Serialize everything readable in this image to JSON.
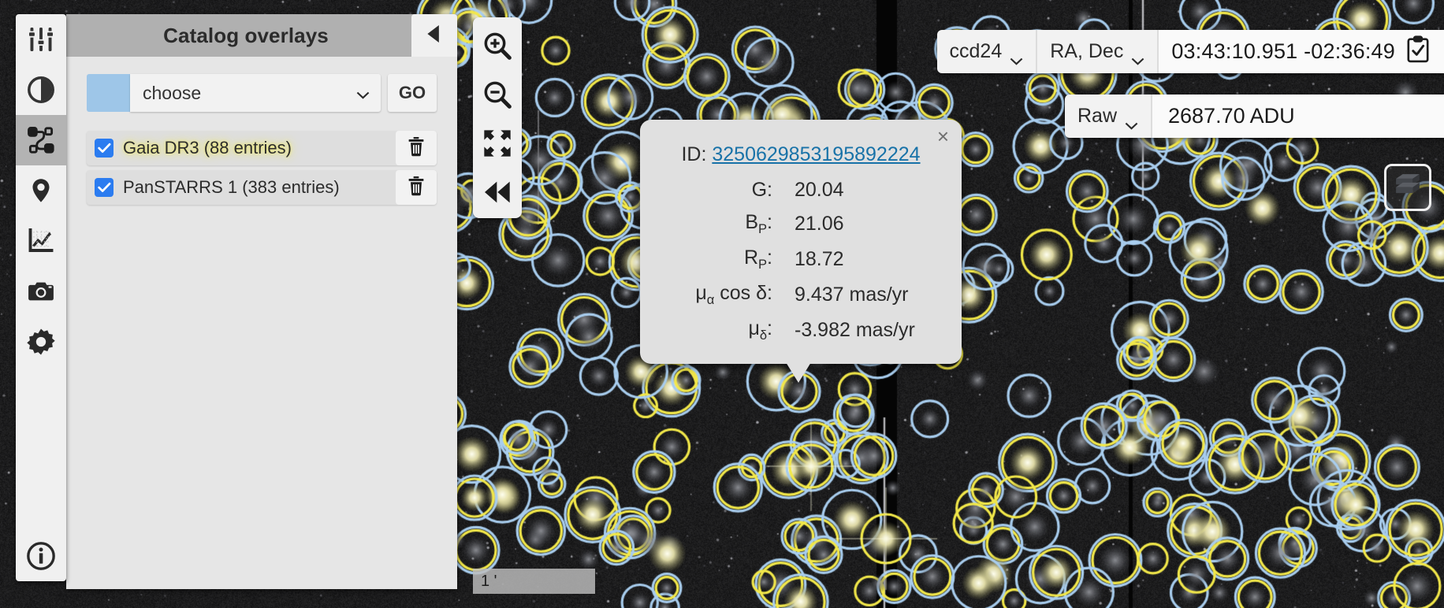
{
  "app": {
    "title": "Astronomical image viewer"
  },
  "rail": {
    "items": [
      {
        "name": "sliders-icon",
        "label": "Adjust",
        "active": false
      },
      {
        "name": "contrast-icon",
        "label": "Contrast",
        "active": false
      },
      {
        "name": "catalog-overlay-icon",
        "label": "Catalog overlays",
        "active": true
      },
      {
        "name": "pin-icon",
        "label": "Markers",
        "active": false
      },
      {
        "name": "chart-icon",
        "label": "Plots",
        "active": false
      },
      {
        "name": "camera-icon",
        "label": "Snapshot",
        "active": false
      },
      {
        "name": "gear-icon",
        "label": "Settings",
        "active": false
      }
    ],
    "info": {
      "name": "info-icon",
      "label": "About"
    }
  },
  "panel": {
    "title": "Catalog overlays",
    "collapse_icon": "chevron-left-icon",
    "chooser": {
      "swatch_color": "#9ec6e8",
      "selected": "choose",
      "options": [
        "choose"
      ],
      "go_label": "GO"
    },
    "catalogs": [
      {
        "label": "Gaia DR3 (88 entries)",
        "checked": true,
        "highlighted": true
      },
      {
        "label": "PanSTARRS 1 (383 entries)",
        "checked": true,
        "highlighted": false
      }
    ]
  },
  "zoom_tools": [
    {
      "name": "zoom-in-icon",
      "label": "Zoom in"
    },
    {
      "name": "zoom-out-icon",
      "label": "Zoom out"
    },
    {
      "name": "fit-to-screen-icon",
      "label": "Zoom to fit"
    },
    {
      "name": "rewind-icon",
      "label": "Reset view"
    }
  ],
  "toolbar": {
    "ccd_selected": "ccd24",
    "ccd_options": [
      "ccd24"
    ],
    "coord_system_selected": "RA, Dec",
    "coord_system_options": [
      "RA, Dec"
    ],
    "coordinates": "03:43:10.951 -02:36:49",
    "copy_icon": "clipboard-check-icon",
    "value_mode_selected": "Raw",
    "value_mode_options": [
      "Raw"
    ],
    "pixel_value": "2687.70 ADU"
  },
  "layers_button": {
    "icon": "layers-cube-icon",
    "label": "Layers"
  },
  "scalebar": {
    "label": "1 '"
  },
  "star_tooltip": {
    "close_label": "×",
    "id_label": "ID:",
    "id_value": "3250629853195892224",
    "rows": [
      {
        "key": "G:",
        "key_sub": "",
        "value": "20.04"
      },
      {
        "key": "B",
        "key_sub": "P",
        "key_suffix": ":",
        "value": "21.06"
      },
      {
        "key": "R",
        "key_sub": "P",
        "key_suffix": ":",
        "value": "18.72"
      },
      {
        "key": "μ",
        "key_sub": "α",
        "key_suffix": " cos δ:",
        "value": "9.437 mas/yr"
      },
      {
        "key": "μ",
        "key_sub": "δ",
        "key_suffix": ":",
        "value": "-3.982 mas/yr"
      }
    ]
  },
  "colors": {
    "gaia_circle": "#f2e84a",
    "panstarrs_circle": "#a8cdee",
    "checkbox_blue": "#2b7cf0",
    "link_blue": "#1872a8",
    "panel_bg": "#e6e6e6",
    "panel_header": "#b0b0b0",
    "sky_bg": "#141414"
  }
}
